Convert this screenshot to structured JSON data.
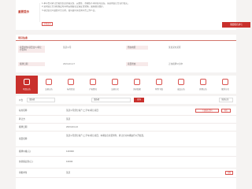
{
  "notice": {
    "title": "重要提示",
    "lines": [
      "1.本平台对转让方提供信息的真实性、完整性、准确性不承担任何责任，请意向受让方自行核实。",
      "2.意向受让方须在规定时间内完成报名及保证金交纳，逾期视为放弃。",
      "3.项目信息以最终公告为准，如有疑问请咨询平台工作人员。"
    ],
    "more_button": "查看更多",
    "apply_button": "我要报名参与"
  },
  "info": {
    "header": "项目信息",
    "fields": [
      {
        "label": "项目单位(项目法人/转让方名称)",
        "value": "某某公司"
      },
      {
        "label": "所在地区",
        "value": "某省某市某区"
      },
      {
        "label": "挂牌日期",
        "value": "2024-04-17"
      },
      {
        "label": "项目状态",
        "value": "正在挂牌公示中"
      }
    ]
  },
  "tabs": [
    {
      "label": "项目公告",
      "icon": "notice-icon"
    },
    {
      "label": "交易公告",
      "icon": "announcement-icon"
    },
    {
      "label": "标的信息",
      "icon": "target-icon"
    },
    {
      "label": "产权情况",
      "icon": "property-icon"
    },
    {
      "label": "交易方式",
      "icon": "trade-icon"
    },
    {
      "label": "竞价结果",
      "icon": "result-icon"
    },
    {
      "label": "附件下载",
      "icon": "download-icon"
    },
    {
      "label": "成交公告",
      "icon": "deal-icon"
    },
    {
      "label": "其他公告",
      "icon": "other-icon"
    },
    {
      "label": "联系方式",
      "icon": "contact-icon"
    }
  ],
  "filter": {
    "label": "公告",
    "select1": "请选择",
    "select2": "请选择",
    "go": "查询",
    "right": "全部公告"
  },
  "detail": {
    "rows": [
      {
        "key": "标的名称",
        "value": "某某公司部分资产(二手车)转让项目"
      },
      {
        "key": "转让方",
        "value": "某某"
      },
      {
        "key": "挂牌日期",
        "value": "2024-04-12"
      },
      {
        "key": "项目名称",
        "value": "某某公司部分资产(二手车)转让项目，车辆信息详见附件，转让方对车辆进行公开处置。"
      },
      {
        "key": "挂牌价格(元)",
        "value": "120000"
      },
      {
        "key": "交易保证金(元)",
        "value": "10000"
      },
      {
        "key": "审批单位",
        "value": "某某"
      }
    ],
    "download_button": "下载报名资料",
    "apply_mini_button": "报名",
    "view_button": "查看"
  }
}
